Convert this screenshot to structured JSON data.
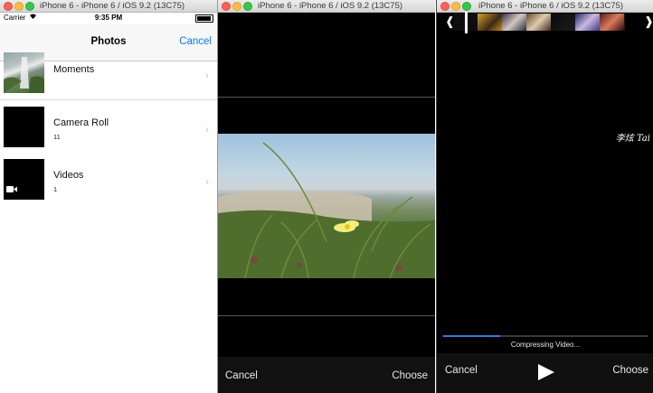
{
  "windows": [
    {
      "title": "iPhone 6 - iPhone 6 / iOS 9.2 (13C75)"
    },
    {
      "title": "iPhone 6 - iPhone 6 / iOS 9.2 (13C75)"
    },
    {
      "title": "iPhone 6 - iPhone 6 / iOS 9.2 (13C75)"
    }
  ],
  "photos": {
    "status": {
      "carrier": "Carrier",
      "time": "9:35 PM"
    },
    "nav": {
      "title": "Photos",
      "cancel": "Cancel"
    },
    "albums": [
      {
        "title": "Moments",
        "count": ""
      },
      {
        "title": "Camera Roll",
        "count": "11"
      },
      {
        "title": "Videos",
        "count": "1"
      }
    ]
  },
  "crop": {
    "cancel": "Cancel",
    "choose": "Choose"
  },
  "video": {
    "caption": "李炫 Tai",
    "progress": 0.28,
    "status_text": "Compressing Video...",
    "cancel": "Cancel",
    "choose": "Choose"
  },
  "colors": {
    "ios_blue": "#0a7aff",
    "progress_blue": "#3b79d9"
  }
}
